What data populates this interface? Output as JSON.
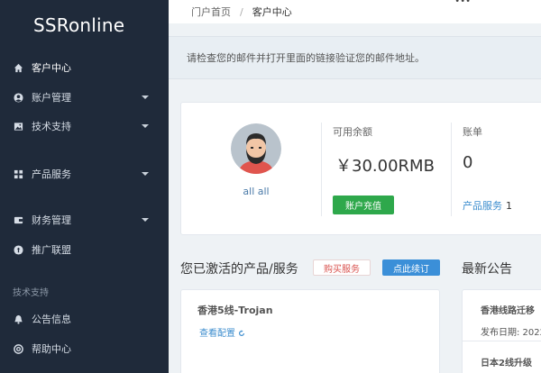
{
  "sidebar": {
    "brand": "SSRonline",
    "items": [
      {
        "label": "客户中心",
        "icon": "home-icon",
        "active": true
      },
      {
        "label": "账户管理",
        "icon": "user-circle-icon",
        "caret": true
      },
      {
        "label": "技术支持",
        "icon": "image-icon",
        "caret": true
      },
      {
        "label": "产品服务",
        "icon": "grid-icon",
        "caret": true
      },
      {
        "label": "财务管理",
        "icon": "wallet-icon",
        "caret": true
      },
      {
        "label": "推广联盟",
        "icon": "gift-icon"
      },
      {
        "label": "公告信息",
        "icon": "bell-icon"
      },
      {
        "label": "帮助中心",
        "icon": "help-circle-icon"
      }
    ],
    "section_heading": "技术支持"
  },
  "breadcrumb": {
    "home": "门户首页",
    "separator": "/",
    "current": "客户中心"
  },
  "notice": "请检查您的邮件并打开里面的链接验证您的邮件地址。",
  "account": {
    "user_name": "all all",
    "balance_label": "可用余额",
    "balance_value": "￥30.00RMB",
    "recharge_label": "账户充值",
    "bill_label": "账单",
    "bill_count": "0",
    "product_link_label": "产品服务",
    "product_count": "1"
  },
  "products": {
    "title": "您已激活的产品/服务",
    "buy_label": "购买服务",
    "renew_label": "点此续订",
    "items": [
      {
        "name": "香港5线-Trojan",
        "config_label": "查看配置"
      }
    ]
  },
  "news": {
    "title": "最新公告",
    "items": [
      {
        "title": "香港线路迁移",
        "date": "发布日期: 2022-"
      },
      {
        "title": "日本2线升级"
      }
    ]
  },
  "colors": {
    "sidebar_bg": "#1f2a3a",
    "accent_green": "#2ea84b",
    "accent_blue": "#3b8fd8",
    "link_blue": "#3c8dce",
    "danger_red": "#d9534f"
  }
}
